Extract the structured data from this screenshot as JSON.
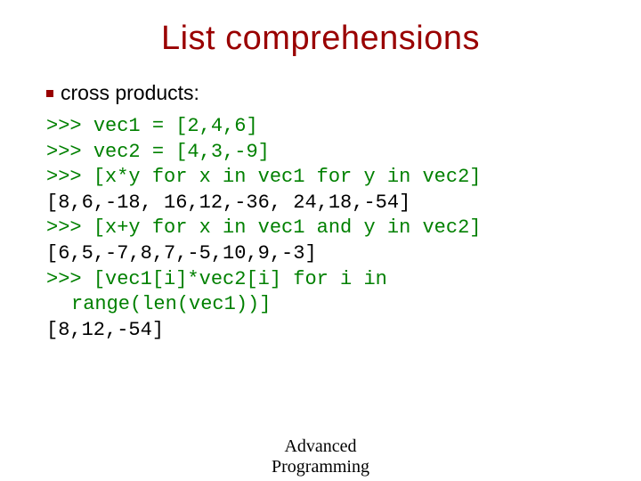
{
  "title": "List comprehensions",
  "bullet": "cross products:",
  "code": {
    "l1_prompt": ">>> ",
    "l1_rest": "vec1 = [2,4,6]",
    "l2_prompt": ">>> ",
    "l2_rest": "vec2 = [4,3,-9]",
    "l3_prompt": ">>> ",
    "l3_rest": "[x*y for x in vec1 for y in vec2]",
    "l4_out": "[8,6,-18, 16,12,-36, 24,18,-54]",
    "l5_prompt": ">>> ",
    "l5_rest": "[x+y for x in vec1 and y in vec2]",
    "l6_out": "[6,5,-7,8,7,-5,10,9,-3]",
    "l7_prompt": ">>> ",
    "l7_rest": "[vec1[i]*vec2[i] for i in",
    "l7_cont": "range(len(vec1))]",
    "l8_out": "[8,12,-54]"
  },
  "footer1": "Advanced",
  "footer2": "Programming"
}
